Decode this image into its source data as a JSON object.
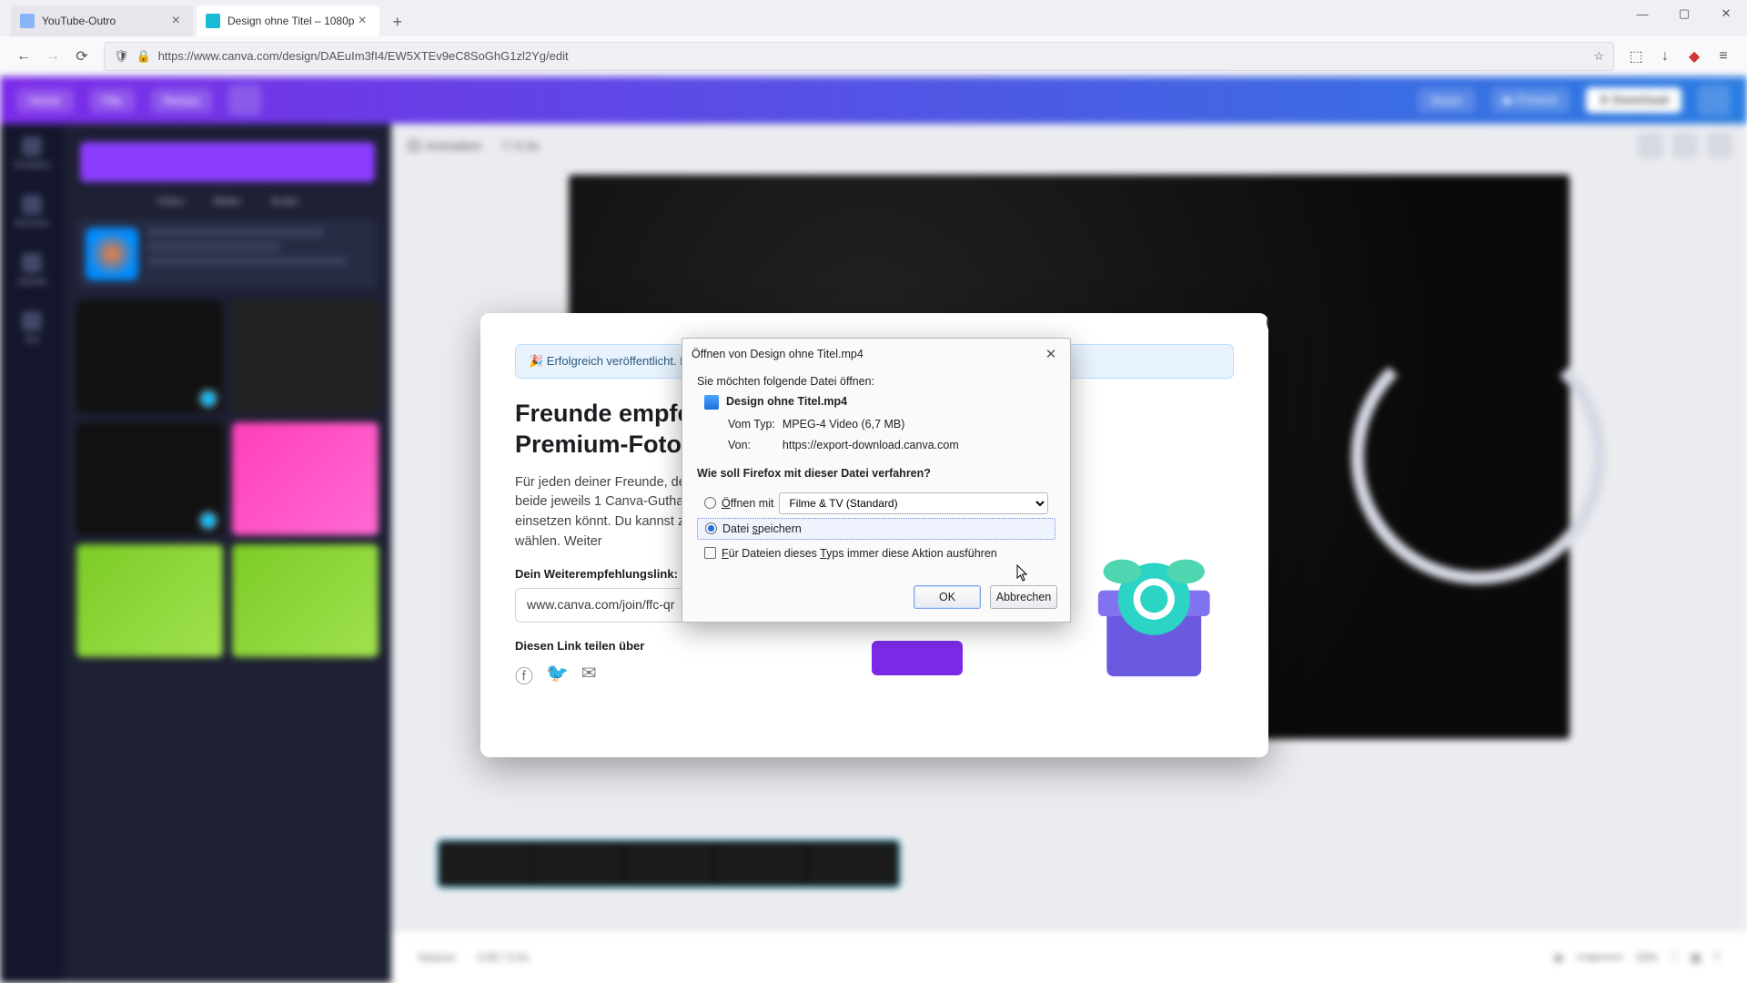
{
  "browser": {
    "tabs": [
      {
        "title": "YouTube-Outro",
        "favicon": "#8ab4f8"
      },
      {
        "title": "Design ohne Titel – 1080p",
        "favicon": "#17bcd4"
      }
    ],
    "url": "https://www.canva.com/design/DAEuIm3fI4/EW5XTEv9eC8SoGhG1zl2Yg/edit",
    "window_controls": {
      "min": "—",
      "max": "▢",
      "close": "✕"
    }
  },
  "canva_modal": {
    "close": "✕",
    "banner": "🎉  Erfolgreich veröffentlicht. F",
    "heading_l1": "Freunde empfeh",
    "heading_l2": "Premium-Fotos.",
    "body": "Für jeden deiner Freunde, der sich über deinen Link bei Canva anmeldet, erhaltet ihr beide jeweils 1 Canva-Guthaben. Damit könnt ihr ein kostenpflichtiges Element einsetzen könnt. Du kannst zwischen Premium-Fotos, -Symbolen und -Illustrationen wählen. Weiter",
    "link_label": "Dein Weiterempfehlungslink:",
    "link_value": "www.canva.com/join/ffc-qr",
    "share_label": "Diesen Link teilen über"
  },
  "ff_dialog": {
    "title": "Öffnen von Design ohne Titel.mp4",
    "prompt": "Sie möchten folgende Datei öffnen:",
    "filename": "Design ohne Titel.mp4",
    "type_label": "Vom Typ:",
    "type_value": "MPEG-4 Video (6,7 MB)",
    "from_label": "Von:",
    "from_value": "https://export-download.canva.com",
    "question": "Wie soll Firefox mit dieser Datei verfahren?",
    "open_with": "Öffnen mit",
    "open_app": "Filme & TV (Standard)",
    "save": "Datei speichern",
    "always": "Für Dateien dieses Typs immer diese Aktion ausführen",
    "ok": "OK",
    "cancel": "Abbrechen",
    "close": "✕"
  },
  "app": {
    "timeline_time": "0:00 / 5.0s",
    "zoom_label": "33%"
  }
}
